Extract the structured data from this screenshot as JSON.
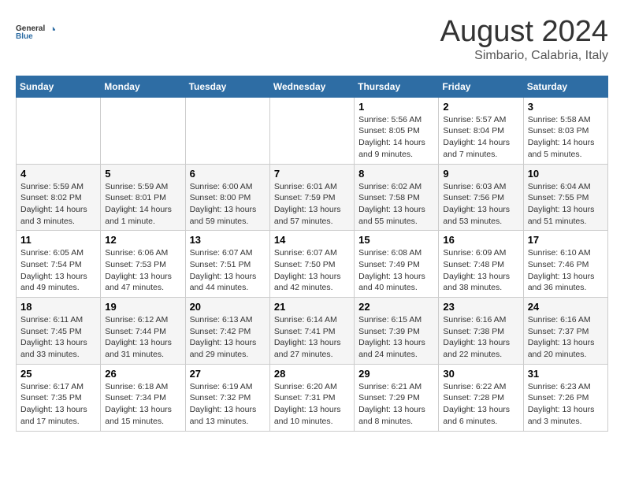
{
  "logo": {
    "text_general": "General",
    "text_blue": "Blue"
  },
  "title": "August 2024",
  "subtitle": "Simbario, Calabria, Italy",
  "days_of_week": [
    "Sunday",
    "Monday",
    "Tuesday",
    "Wednesday",
    "Thursday",
    "Friday",
    "Saturday"
  ],
  "weeks": [
    [
      {
        "day": "",
        "info": ""
      },
      {
        "day": "",
        "info": ""
      },
      {
        "day": "",
        "info": ""
      },
      {
        "day": "",
        "info": ""
      },
      {
        "day": "1",
        "info": "Sunrise: 5:56 AM\nSunset: 8:05 PM\nDaylight: 14 hours\nand 9 minutes."
      },
      {
        "day": "2",
        "info": "Sunrise: 5:57 AM\nSunset: 8:04 PM\nDaylight: 14 hours\nand 7 minutes."
      },
      {
        "day": "3",
        "info": "Sunrise: 5:58 AM\nSunset: 8:03 PM\nDaylight: 14 hours\nand 5 minutes."
      }
    ],
    [
      {
        "day": "4",
        "info": "Sunrise: 5:59 AM\nSunset: 8:02 PM\nDaylight: 14 hours\nand 3 minutes."
      },
      {
        "day": "5",
        "info": "Sunrise: 5:59 AM\nSunset: 8:01 PM\nDaylight: 14 hours\nand 1 minute."
      },
      {
        "day": "6",
        "info": "Sunrise: 6:00 AM\nSunset: 8:00 PM\nDaylight: 13 hours\nand 59 minutes."
      },
      {
        "day": "7",
        "info": "Sunrise: 6:01 AM\nSunset: 7:59 PM\nDaylight: 13 hours\nand 57 minutes."
      },
      {
        "day": "8",
        "info": "Sunrise: 6:02 AM\nSunset: 7:58 PM\nDaylight: 13 hours\nand 55 minutes."
      },
      {
        "day": "9",
        "info": "Sunrise: 6:03 AM\nSunset: 7:56 PM\nDaylight: 13 hours\nand 53 minutes."
      },
      {
        "day": "10",
        "info": "Sunrise: 6:04 AM\nSunset: 7:55 PM\nDaylight: 13 hours\nand 51 minutes."
      }
    ],
    [
      {
        "day": "11",
        "info": "Sunrise: 6:05 AM\nSunset: 7:54 PM\nDaylight: 13 hours\nand 49 minutes."
      },
      {
        "day": "12",
        "info": "Sunrise: 6:06 AM\nSunset: 7:53 PM\nDaylight: 13 hours\nand 47 minutes."
      },
      {
        "day": "13",
        "info": "Sunrise: 6:07 AM\nSunset: 7:51 PM\nDaylight: 13 hours\nand 44 minutes."
      },
      {
        "day": "14",
        "info": "Sunrise: 6:07 AM\nSunset: 7:50 PM\nDaylight: 13 hours\nand 42 minutes."
      },
      {
        "day": "15",
        "info": "Sunrise: 6:08 AM\nSunset: 7:49 PM\nDaylight: 13 hours\nand 40 minutes."
      },
      {
        "day": "16",
        "info": "Sunrise: 6:09 AM\nSunset: 7:48 PM\nDaylight: 13 hours\nand 38 minutes."
      },
      {
        "day": "17",
        "info": "Sunrise: 6:10 AM\nSunset: 7:46 PM\nDaylight: 13 hours\nand 36 minutes."
      }
    ],
    [
      {
        "day": "18",
        "info": "Sunrise: 6:11 AM\nSunset: 7:45 PM\nDaylight: 13 hours\nand 33 minutes."
      },
      {
        "day": "19",
        "info": "Sunrise: 6:12 AM\nSunset: 7:44 PM\nDaylight: 13 hours\nand 31 minutes."
      },
      {
        "day": "20",
        "info": "Sunrise: 6:13 AM\nSunset: 7:42 PM\nDaylight: 13 hours\nand 29 minutes."
      },
      {
        "day": "21",
        "info": "Sunrise: 6:14 AM\nSunset: 7:41 PM\nDaylight: 13 hours\nand 27 minutes."
      },
      {
        "day": "22",
        "info": "Sunrise: 6:15 AM\nSunset: 7:39 PM\nDaylight: 13 hours\nand 24 minutes."
      },
      {
        "day": "23",
        "info": "Sunrise: 6:16 AM\nSunset: 7:38 PM\nDaylight: 13 hours\nand 22 minutes."
      },
      {
        "day": "24",
        "info": "Sunrise: 6:16 AM\nSunset: 7:37 PM\nDaylight: 13 hours\nand 20 minutes."
      }
    ],
    [
      {
        "day": "25",
        "info": "Sunrise: 6:17 AM\nSunset: 7:35 PM\nDaylight: 13 hours\nand 17 minutes."
      },
      {
        "day": "26",
        "info": "Sunrise: 6:18 AM\nSunset: 7:34 PM\nDaylight: 13 hours\nand 15 minutes."
      },
      {
        "day": "27",
        "info": "Sunrise: 6:19 AM\nSunset: 7:32 PM\nDaylight: 13 hours\nand 13 minutes."
      },
      {
        "day": "28",
        "info": "Sunrise: 6:20 AM\nSunset: 7:31 PM\nDaylight: 13 hours\nand 10 minutes."
      },
      {
        "day": "29",
        "info": "Sunrise: 6:21 AM\nSunset: 7:29 PM\nDaylight: 13 hours\nand 8 minutes."
      },
      {
        "day": "30",
        "info": "Sunrise: 6:22 AM\nSunset: 7:28 PM\nDaylight: 13 hours\nand 6 minutes."
      },
      {
        "day": "31",
        "info": "Sunrise: 6:23 AM\nSunset: 7:26 PM\nDaylight: 13 hours\nand 3 minutes."
      }
    ]
  ]
}
